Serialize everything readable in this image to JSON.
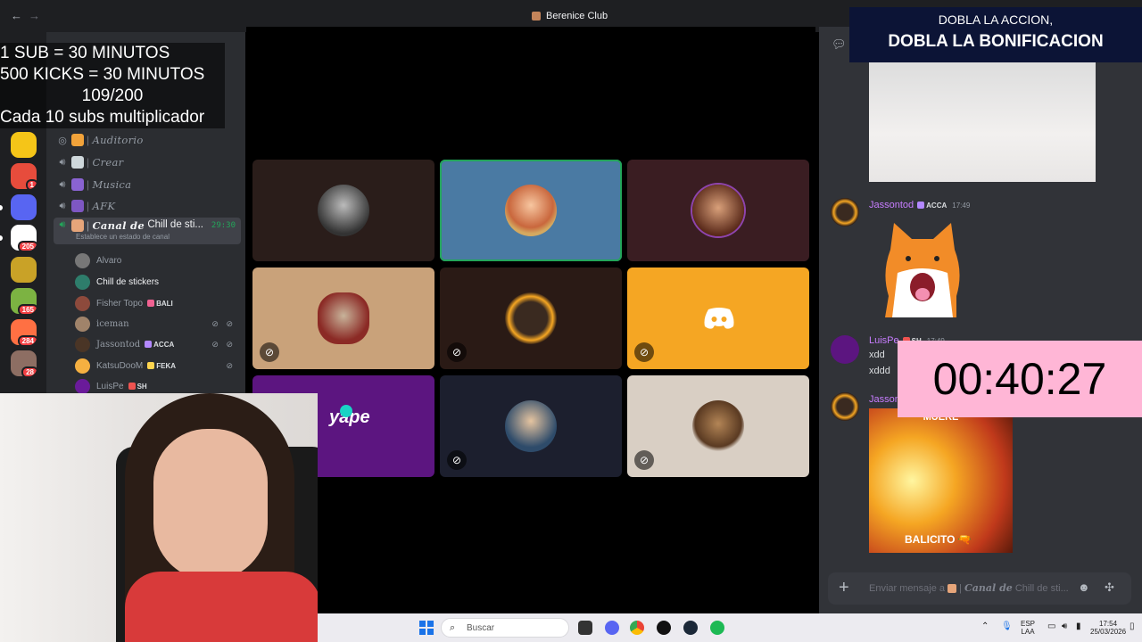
{
  "window": {
    "title": "Berenice Club",
    "back": "←",
    "forward": "→"
  },
  "overlay": {
    "line1": "1 SUB    = 30 MINUTOS",
    "line2": "500 KICKS = 30 MINUTOS",
    "line3": "109/200",
    "line4": "Cada 10 subs multiplicador"
  },
  "servers": [
    {
      "name": "server-1",
      "color": "#f5c518",
      "badge": ""
    },
    {
      "name": "server-2",
      "color": "#e74c3c",
      "badge": "1"
    },
    {
      "name": "discord",
      "color": "#5865f2",
      "badge": ""
    },
    {
      "name": "server-4",
      "color": "#ffffff",
      "badge": "205"
    },
    {
      "name": "server-5",
      "color": "#c9a227",
      "badge": ""
    },
    {
      "name": "server-6",
      "color": "#7cb342",
      "badge": "165"
    },
    {
      "name": "server-7",
      "color": "#ff7043",
      "badge": "284"
    },
    {
      "name": "server-8",
      "color": "#8d6e63",
      "badge": "28"
    }
  ],
  "channels": [
    {
      "icon": "◎",
      "emoji_color": "#f2a33a",
      "name": "Auditorio"
    },
    {
      "icon": "🔊︎",
      "emoji_color": "#cfd8dc",
      "name": "Crear"
    },
    {
      "icon": "🔊︎",
      "emoji_color": "#8a63d2",
      "name": "Musica"
    },
    {
      "icon": "🔊︎",
      "emoji_color": "#7e57c2",
      "name": "AFK"
    }
  ],
  "active_channel": {
    "prefix": "Canal de",
    "name": "Chill de sti...",
    "timer": "29:30",
    "status": "Establece un estado de canal"
  },
  "members": [
    {
      "name": "Alvaro",
      "tag": "",
      "tag_color": "",
      "avatar": "#777777",
      "muted": "",
      "bright": false
    },
    {
      "name": "Chill de stickers",
      "tag": "",
      "tag_color": "",
      "avatar": "#2e7d6b",
      "muted": "",
      "bright": true
    },
    {
      "name": "Fisher Topo",
      "tag": "BALI",
      "tag_color": "#f06292",
      "avatar": "#8d4a3c",
      "muted": "",
      "bright": false
    },
    {
      "name": "iceman",
      "tag": "",
      "tag_color": "",
      "avatar": "#a0836a",
      "muted": "⊘ ⊘",
      "bright": false
    },
    {
      "name": "Jassontod",
      "tag": "ACCA",
      "tag_color": "#b388ff",
      "avatar": "#4a3526",
      "muted": "⊘ ⊘",
      "bright": false
    },
    {
      "name": "KatsuDooM",
      "tag": "FEKA",
      "tag_color": "#ffd54f",
      "avatar": "#f5b041",
      "muted": "⊘",
      "bright": false
    },
    {
      "name": "LuisPe",
      "tag": "SH",
      "tag_color": "#ef5350",
      "avatar": "#6a1b9a",
      "muted": "",
      "bright": false
    }
  ],
  "tiles": [
    {
      "name": "tile-alvaro",
      "bg": "#2a1d1a",
      "avatar": "#3a3a3a",
      "muted": false,
      "speaking": false
    },
    {
      "name": "tile-chill-de-stickers",
      "bg": "#4a7aa3",
      "avatar": "#c9673d",
      "muted": false,
      "speaking": true
    },
    {
      "name": "tile-fisher-topo",
      "bg": "#3a1d22",
      "avatar": "#7b4a3a",
      "muted": false,
      "speaking": false
    },
    {
      "name": "tile-iceman",
      "bg": "#c9a27a",
      "avatar": "#8b2a25",
      "muted": true,
      "speaking": false
    },
    {
      "name": "tile-jassontod",
      "bg": "#2a1a15",
      "avatar": "#c46a1a",
      "muted": true,
      "speaking": false
    },
    {
      "name": "tile-katsudoom",
      "bg": "#f5a623",
      "avatar": "#f5a623",
      "muted": true,
      "speaking": false
    },
    {
      "name": "tile-luispe",
      "bg": "#5c1580",
      "avatar": "#5c1580",
      "muted": false,
      "speaking": false
    },
    {
      "name": "tile-user-8",
      "bg": "#1c1f2e",
      "avatar": "#3f5d7a",
      "muted": true,
      "speaking": false
    },
    {
      "name": "tile-user-9",
      "bg": "#d9cfc4",
      "avatar": "#7a5a3a",
      "muted": true,
      "speaking": false
    }
  ],
  "yape_label": "yape",
  "chat": {
    "messages": [
      {
        "user": "Jassontod",
        "tag": "ACCA",
        "tag_color": "#b388ff",
        "time": "17:49",
        "avatar": "#c46a1a"
      },
      {
        "user": "LuisPe",
        "tag": "SH",
        "tag_color": "#ef5350",
        "time": "17:49",
        "avatar": "#5c1580",
        "lines": [
          "xdd",
          "xddd"
        ]
      },
      {
        "user": "Jassontod",
        "tag": "",
        "tag_color": "",
        "time": "",
        "avatar": "#c46a1a"
      }
    ],
    "gif_top_text": "MUERE",
    "gif_caption": "BALICITO 🔫",
    "composer_prefix": "Enviar mensaje a",
    "composer_channel": "Canal de",
    "composer_rest": "Chill de sti..."
  },
  "promo": {
    "line1": "DOBLA LA ACCION,",
    "line2": "DOBLA LA BONIFICACION"
  },
  "countdown": "00:40:27",
  "taskbar": {
    "search": "Buscar",
    "lang1": "ESP",
    "lang2": "LAA",
    "time": "17:54",
    "date": "25/03/2026"
  }
}
